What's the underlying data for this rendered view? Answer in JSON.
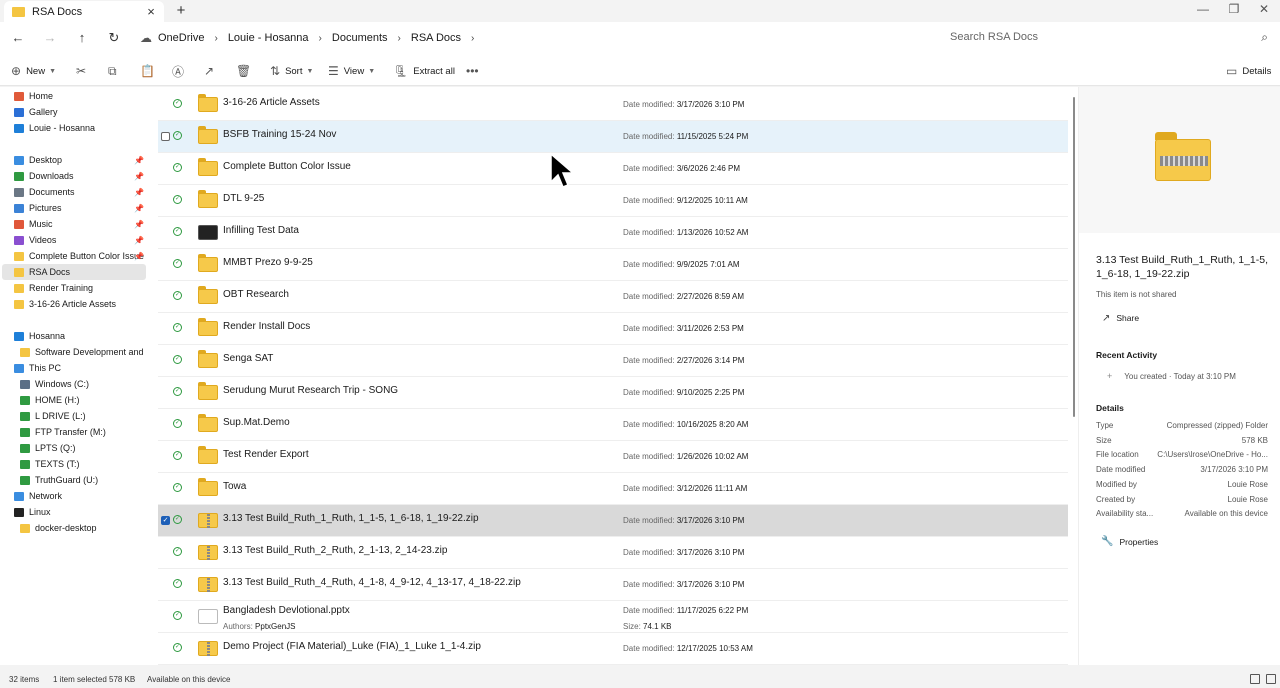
{
  "tab": {
    "title": "RSA Docs"
  },
  "breadcrumb": [
    "OneDrive",
    "Louie - Hosanna",
    "Documents",
    "RSA Docs"
  ],
  "search": {
    "placeholder": "Search RSA Docs"
  },
  "toolbar": {
    "new": "New",
    "sort": "Sort",
    "view": "View",
    "extract": "Extract all",
    "details": "Details"
  },
  "sidebar": {
    "items": [
      {
        "label": "Home",
        "color": "#e05a3a"
      },
      {
        "label": "Gallery",
        "color": "#2b6fd6"
      },
      {
        "label": "Louie - Hosanna",
        "color": "#1e7fd8"
      },
      {
        "label": "Desktop",
        "color": "#3a8de0"
      },
      {
        "label": "Downloads",
        "color": "#2f9a41"
      },
      {
        "label": "Documents",
        "color": "#6b7785"
      },
      {
        "label": "Pictures",
        "color": "#3b82d6"
      },
      {
        "label": "Music",
        "color": "#e0573a"
      },
      {
        "label": "Videos",
        "color": "#8a4fd0"
      },
      {
        "label": "Complete Button Color Issue",
        "color": "#f4c542"
      },
      {
        "label": "RSA Docs",
        "color": "#f4c542"
      },
      {
        "label": "Render Training",
        "color": "#f4c542"
      },
      {
        "label": "3-16-26 Article Assets",
        "color": "#f4c542"
      },
      {
        "label": "Hosanna",
        "color": "#1e7fd8"
      },
      {
        "label": "Software Development and Sup",
        "color": "#f4c542"
      },
      {
        "label": "This PC",
        "color": "#3a8de0"
      },
      {
        "label": "Windows  (C:)",
        "color": "#5b6f86"
      },
      {
        "label": "HOME (H:)",
        "color": "#2f9a41"
      },
      {
        "label": "L DRIVE (L:)",
        "color": "#2f9a41"
      },
      {
        "label": "FTP Transfer (M:)",
        "color": "#2f9a41"
      },
      {
        "label": "LPTS (Q:)",
        "color": "#2f9a41"
      },
      {
        "label": "TEXTS (T:)",
        "color": "#2f9a41"
      },
      {
        "label": "TruthGuard (U:)",
        "color": "#2f9a41"
      },
      {
        "label": "Network",
        "color": "#3a8de0"
      },
      {
        "label": "Linux",
        "color": "#222222"
      },
      {
        "label": "docker-desktop",
        "color": "#f4c542"
      }
    ]
  },
  "files": [
    {
      "name": "3-16-26 Article Assets",
      "type": "folder",
      "modified": "3/17/2026 3:10 PM"
    },
    {
      "name": "BSFB Training 15-24 Nov",
      "type": "folder",
      "modified": "11/15/2025 5:24 PM"
    },
    {
      "name": "Complete Button Color Issue",
      "type": "folder",
      "modified": "3/6/2026 2:46 PM"
    },
    {
      "name": "DTL 9-25",
      "type": "folder",
      "modified": "9/12/2025 10:11 AM"
    },
    {
      "name": "Infilling Test Data",
      "type": "dark",
      "modified": "1/13/2026 10:52 AM"
    },
    {
      "name": "MMBT Prezo 9-9-25",
      "type": "folder",
      "modified": "9/9/2025 7:01 AM"
    },
    {
      "name": "OBT Research",
      "type": "folder",
      "modified": "2/27/2026 8:59 AM"
    },
    {
      "name": "Render Install Docs",
      "type": "folder",
      "modified": "3/11/2026 2:53 PM"
    },
    {
      "name": "Senga SAT",
      "type": "folder",
      "modified": "2/27/2026 3:14 PM"
    },
    {
      "name": "Serudung Murut Research Trip - SONG",
      "type": "folder",
      "modified": "9/10/2025 2:25 PM"
    },
    {
      "name": "Sup.Mat.Demo",
      "type": "folder",
      "modified": "10/16/2025 8:20 AM"
    },
    {
      "name": "Test Render Export",
      "type": "folder",
      "modified": "1/26/2026 10:02 AM"
    },
    {
      "name": "Towa",
      "type": "folder",
      "modified": "3/12/2026 11:11 AM"
    },
    {
      "name": "3.13 Test Build_Ruth_1_Ruth, 1_1-5, 1_6-18, 1_19-22.zip",
      "type": "zip",
      "modified": "3/17/2026 3:10 PM"
    },
    {
      "name": "3.13 Test Build_Ruth_2_Ruth, 2_1-13, 2_14-23.zip",
      "type": "zip",
      "modified": "3/17/2026 3:10 PM"
    },
    {
      "name": "3.13 Test Build_Ruth_4_Ruth, 4_1-8, 4_9-12, 4_13-17, 4_18-22.zip",
      "type": "zip",
      "modified": "3/17/2026 3:10 PM"
    },
    {
      "name": "Bangladesh Devlotional.pptx",
      "type": "pptx",
      "modified": "11/17/2025 6:22 PM",
      "authors": "PptxGenJS",
      "size": "74.1 KB"
    },
    {
      "name": "Demo Project (FIA Material)_Luke (FIA)_1_Luke 1_1-4.zip",
      "type": "zip",
      "modified": "12/17/2025 10:53 AM"
    }
  ],
  "labels": {
    "date_modified": "Date modified:",
    "authors": "Authors:",
    "size": "Size:"
  },
  "details": {
    "title": "3.13 Test Build_Ruth_1_Ruth, 1_1-5, 1_6-18, 1_19-22.zip",
    "share_note": "This item is not shared",
    "share": "Share",
    "recent_heading": "Recent Activity",
    "activity": "You created · Today at 3:10 PM",
    "details_heading": "Details",
    "props": [
      {
        "k": "Type",
        "v": "Compressed (zipped) Folder"
      },
      {
        "k": "Size",
        "v": "578 KB"
      },
      {
        "k": "File location",
        "v": "C:\\Users\\lrose\\OneDrive - Ho..."
      },
      {
        "k": "Date modified",
        "v": "3/17/2026 3:10 PM"
      },
      {
        "k": "Modified by",
        "v": "Louie Rose"
      },
      {
        "k": "Created by",
        "v": "Louie Rose"
      },
      {
        "k": "Availability sta...",
        "v": "Available on this device"
      }
    ],
    "properties_btn": "Properties"
  },
  "status": {
    "count": "32 items",
    "selected": "1 item selected  578 KB",
    "availability": "Available on this device"
  }
}
